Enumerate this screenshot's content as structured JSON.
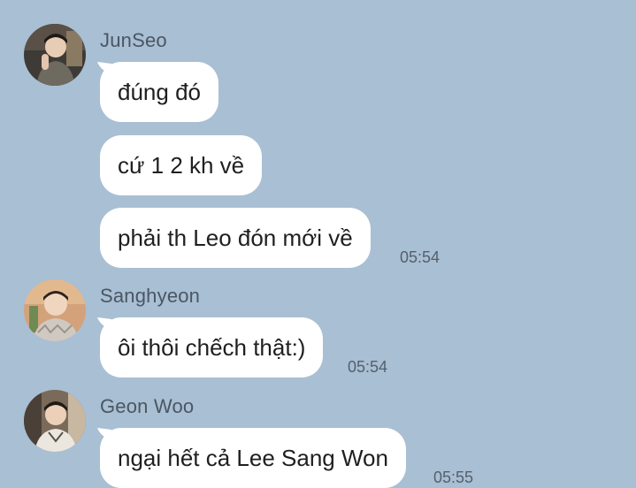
{
  "messages": [
    {
      "sender": "JunSeo",
      "avatar_icon": "profile-photo-junseo",
      "bubbles": [
        "đúng đó",
        "cứ 1 2 kh về",
        "phải th Leo đón mới về"
      ],
      "time": "05:54"
    },
    {
      "sender": "Sanghyeon",
      "avatar_icon": "profile-photo-sanghyeon",
      "bubbles": [
        "ôi thôi chếch thật:)"
      ],
      "time": "05:54"
    },
    {
      "sender": "Geon Woo",
      "avatar_icon": "profile-photo-geonwoo",
      "bubbles": [
        "ngại hết cả Lee Sang Won"
      ],
      "time": "05:55"
    }
  ],
  "colors": {
    "background": "#a9bfd3",
    "bubble": "#ffffff",
    "sender_text": "#4a5664",
    "timestamp_text": "#55606c"
  }
}
